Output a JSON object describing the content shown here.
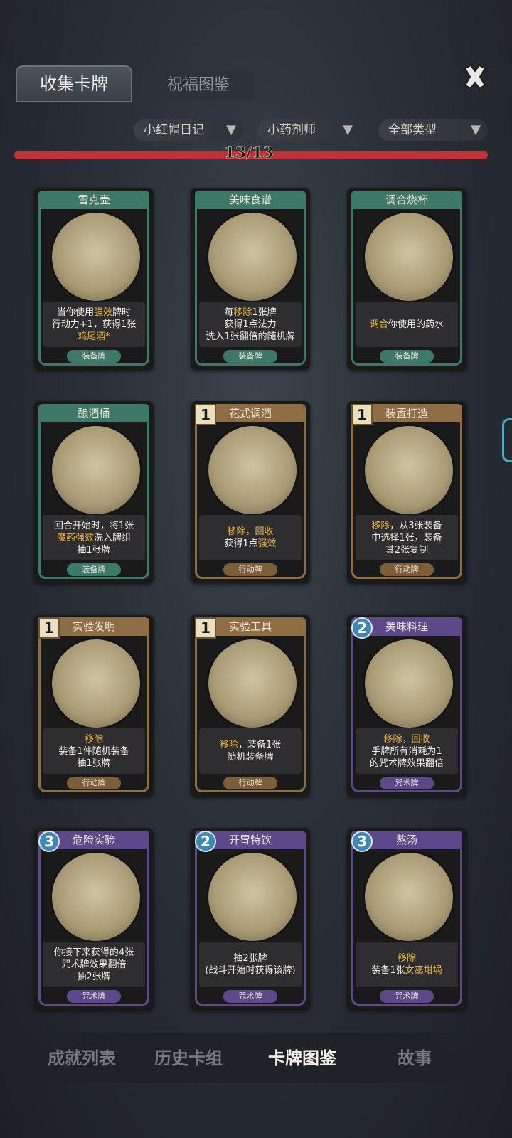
{
  "tabs": [
    {
      "label": "收集卡牌",
      "active": true
    },
    {
      "label": "祝福图鉴",
      "active": false
    }
  ],
  "close_icon": "close-icon",
  "filters": [
    {
      "label": "小红帽日记",
      "icon": "funnel-icon"
    },
    {
      "label": "小药剂师",
      "icon": "funnel-icon"
    },
    {
      "label": "全部类型",
      "icon": "funnel-icon"
    }
  ],
  "progress": {
    "text": "13/13",
    "collected": 13,
    "total": 13,
    "fraction": 1.0
  },
  "colors": {
    "equip": "#3e7868",
    "action": "#8e6d44",
    "spell": "#5d4989",
    "highlight": "#e7b43a",
    "progress": "#c1313a"
  },
  "cards": [
    {
      "name": "雪克壶",
      "category": "equip",
      "cost": "",
      "type": "装备牌",
      "lines": [
        [
          {
            "t": "当你使用"
          },
          {
            "t": "强效",
            "hl": true
          },
          {
            "t": "牌时"
          }
        ],
        [
          {
            "t": "行动力+1，获得1张"
          }
        ],
        [
          {
            "t": "鸡尾酒*",
            "hl": true
          }
        ]
      ]
    },
    {
      "name": "美味食谱",
      "category": "equip",
      "cost": "",
      "type": "装备牌",
      "lines": [
        [
          {
            "t": "每"
          },
          {
            "t": "移除",
            "hl": true
          },
          {
            "t": "1张牌"
          }
        ],
        [
          {
            "t": "获得1点法力"
          }
        ],
        [
          {
            "t": "洗入1张翻倍的随机牌"
          }
        ]
      ]
    },
    {
      "name": "调合烧杯",
      "category": "equip",
      "cost": "",
      "type": "装备牌",
      "lines": [
        [
          {
            "t": "调合",
            "hl": true
          },
          {
            "t": "你使用的药水"
          }
        ]
      ]
    },
    {
      "name": "酿酒桶",
      "category": "equip",
      "cost": "",
      "type": "装备牌",
      "lines": [
        [
          {
            "t": "回合开始时，将1张"
          }
        ],
        [
          {
            "t": "魔药强效",
            "hl": true
          },
          {
            "t": "洗入牌组"
          }
        ],
        [
          {
            "t": "抽1张牌"
          }
        ]
      ]
    },
    {
      "name": "花式调酒",
      "category": "action",
      "cost": "1",
      "type": "行动牌",
      "lines": [
        [
          {
            "t": "移除，回收",
            "hl": true
          }
        ],
        [
          {
            "t": "获得1点"
          },
          {
            "t": "强效",
            "hl": true
          }
        ]
      ]
    },
    {
      "name": "装置打造",
      "category": "action",
      "cost": "1",
      "type": "行动牌",
      "lines": [
        [
          {
            "t": "移除",
            "hl": true
          },
          {
            "t": "，从3张装备"
          }
        ],
        [
          {
            "t": "中选择1张，装备"
          }
        ],
        [
          {
            "t": "其2张复制"
          }
        ]
      ]
    },
    {
      "name": "实验发明",
      "category": "action",
      "cost": "1",
      "type": "行动牌",
      "lines": [
        [
          {
            "t": "移除",
            "hl": true
          }
        ],
        [
          {
            "t": "装备1件随机装备"
          }
        ],
        [
          {
            "t": "抽1张牌"
          }
        ]
      ]
    },
    {
      "name": "实验工具",
      "category": "action",
      "cost": "1",
      "type": "行动牌",
      "lines": [
        [
          {
            "t": "移除",
            "hl": true
          },
          {
            "t": "，装备1张"
          }
        ],
        [
          {
            "t": "随机装备牌"
          }
        ]
      ]
    },
    {
      "name": "美味料理",
      "category": "spell",
      "cost": "2",
      "type": "咒术牌",
      "lines": [
        [
          {
            "t": "移除，回收",
            "hl": true
          }
        ],
        [
          {
            "t": "手牌所有消耗为1"
          }
        ],
        [
          {
            "t": "的咒术牌效果翻倍"
          }
        ]
      ]
    },
    {
      "name": "危险实验",
      "category": "spell",
      "cost": "3",
      "type": "咒术牌",
      "lines": [
        [
          {
            "t": "你接下来获得的4张"
          }
        ],
        [
          {
            "t": "咒术牌效果翻倍"
          }
        ],
        [
          {
            "t": "抽2张牌"
          }
        ]
      ]
    },
    {
      "name": "开胃特饮",
      "category": "spell",
      "cost": "2",
      "type": "咒术牌",
      "lines": [
        [
          {
            "t": "抽2张牌"
          }
        ],
        [
          {
            "t": "(战斗开始时获得该牌)"
          }
        ]
      ]
    },
    {
      "name": "熬汤",
      "category": "spell",
      "cost": "3",
      "type": "咒术牌",
      "lines": [
        [
          {
            "t": "移除",
            "hl": true
          }
        ],
        [
          {
            "t": "装备1张"
          },
          {
            "t": "女巫坩埚",
            "hl": true
          }
        ]
      ]
    }
  ],
  "bottom_nav": [
    {
      "label": "成就列表",
      "active": false
    },
    {
      "label": "历史卡组",
      "active": false
    },
    {
      "label": "卡牌图鉴",
      "active": true
    },
    {
      "label": "故事",
      "active": false
    }
  ]
}
